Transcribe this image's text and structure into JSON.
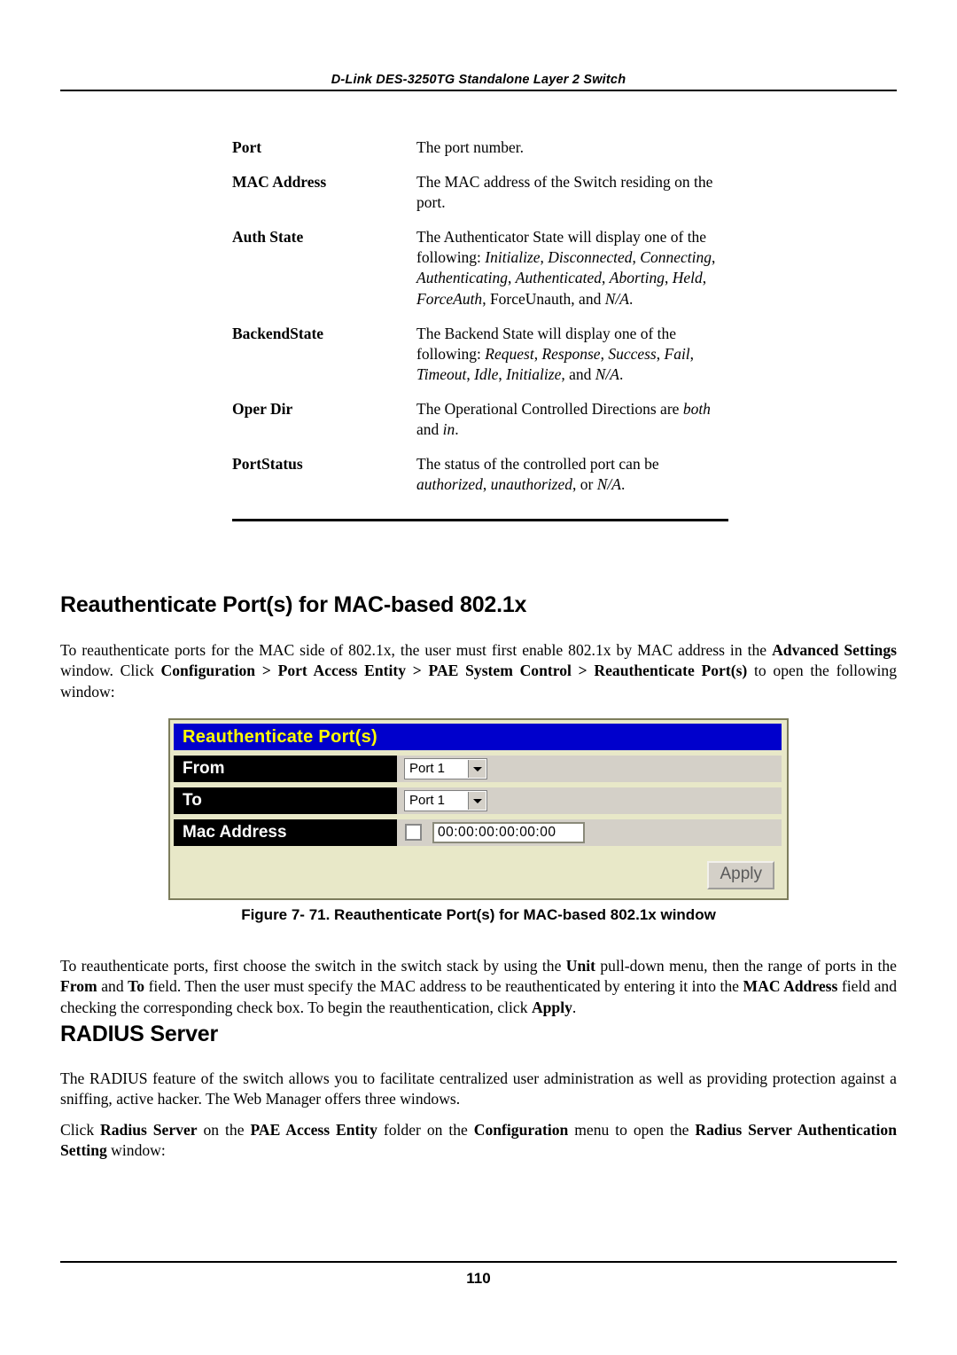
{
  "header": {
    "title": "D-Link DES-3250TG Standalone Layer 2 Switch"
  },
  "definitions": [
    {
      "term": "Port",
      "desc": "The port number."
    },
    {
      "term": "MAC Address",
      "desc": "The MAC address of the Switch residing on the port."
    },
    {
      "term": "Auth State",
      "desc": "The Authenticator State will display one of the following: Initialize, Disconnected, Connecting, Authenticating, Authenticated, Aborting, Held, ForceAuth, ForceUnauth, and N/A."
    },
    {
      "term": "BackendState",
      "desc": "The Backend State will display one of the following: Request, Response, Success, Fail, Timeout, Idle, Initialize, and N/A."
    },
    {
      "term": "Oper Dir",
      "desc": "The Operational Controlled Directions are both and in."
    },
    {
      "term": "PortStatus",
      "desc": "The status of the controlled port can be authorized, unauthorized, or N/A."
    }
  ],
  "sections": {
    "reauth_heading": "Reauthenticate Port(s) for MAC-based 802.1x",
    "reauth_intro": "To reauthenticate ports for the MAC side of 802.1x, the user must first enable 802.1x by MAC address in the Advanced Settings window. Click Configuration > Port Access Entity > PAE System Control > Reauthenticate Port(s) to open the following window:",
    "reauth_after": "To reauthenticate ports, first choose the switch in the switch stack by using the Unit pull-down menu, then the range of ports in the From and To field. Then the user must specify the MAC address to be reauthenticated by entering it into the MAC Address field and checking the corresponding check box. To begin the reauthentication, click Apply.",
    "radius_heading": "RADIUS Server",
    "radius_p1": "The RADIUS feature of the switch allows you to facilitate centralized user administration as well as providing protection against a sniffing, active hacker. The Web Manager offers three windows.",
    "radius_p2": "Click Radius Server on the PAE Access Entity folder on the Configuration menu to open the Radius Server Authentication Setting window:"
  },
  "figure": {
    "window_title": "Reauthenticate Port(s)",
    "rows": [
      {
        "label": "From",
        "value": "Port 1"
      },
      {
        "label": "To",
        "value": "Port 1"
      },
      {
        "label": "Mac Address",
        "value": "00:00:00:00:00:00"
      }
    ],
    "apply_label": "Apply",
    "caption": "Figure 7- 71. Reauthenticate Port(s) for MAC-based 802.1x window",
    "colors": {
      "title_bar": "#0000cc",
      "title_text": "#ffff00",
      "panel_bg": "#e8e8c8",
      "label_bg": "#000000"
    }
  },
  "footer": {
    "page_number": "110"
  }
}
